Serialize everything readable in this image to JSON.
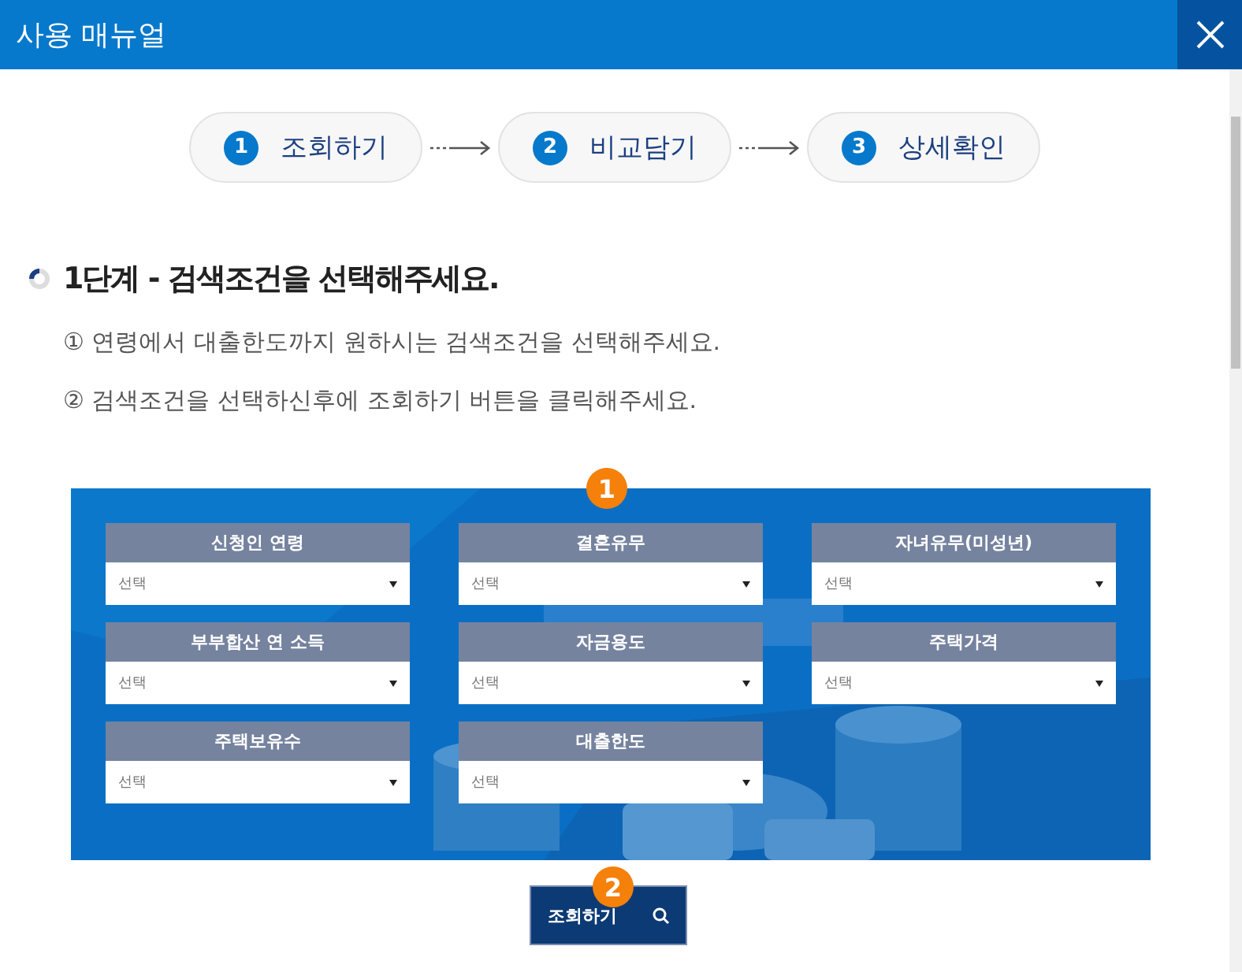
{
  "window": {
    "title": "사용 매뉴얼"
  },
  "steps": [
    {
      "number": "1",
      "label": "조회하기"
    },
    {
      "number": "2",
      "label": "비교담기"
    },
    {
      "number": "3",
      "label": "상세확인"
    }
  ],
  "section": {
    "heading": "1단계 - 검색조건을 선택해주세요.",
    "instructions": [
      "① 연령에서 대출한도까지 원하시는 검색조건을 선택해주세요.",
      "② 검색조건을 선택하신후에 조회하기 버튼을 클릭해주세요."
    ]
  },
  "panel": {
    "badge": "1",
    "fields": [
      {
        "label": "신청인 연령",
        "value": "선택"
      },
      {
        "label": "결혼유무",
        "value": "선택"
      },
      {
        "label": "자녀유무(미성년)",
        "value": "선택"
      },
      {
        "label": "부부합산 연 소득",
        "value": "선택"
      },
      {
        "label": "자금용도",
        "value": "선택"
      },
      {
        "label": "주택가격",
        "value": "선택"
      },
      {
        "label": "주택보유수",
        "value": "선택"
      },
      {
        "label": "대출한도",
        "value": "선택"
      }
    ]
  },
  "search_button": {
    "label": "조회하기",
    "badge": "2"
  }
}
